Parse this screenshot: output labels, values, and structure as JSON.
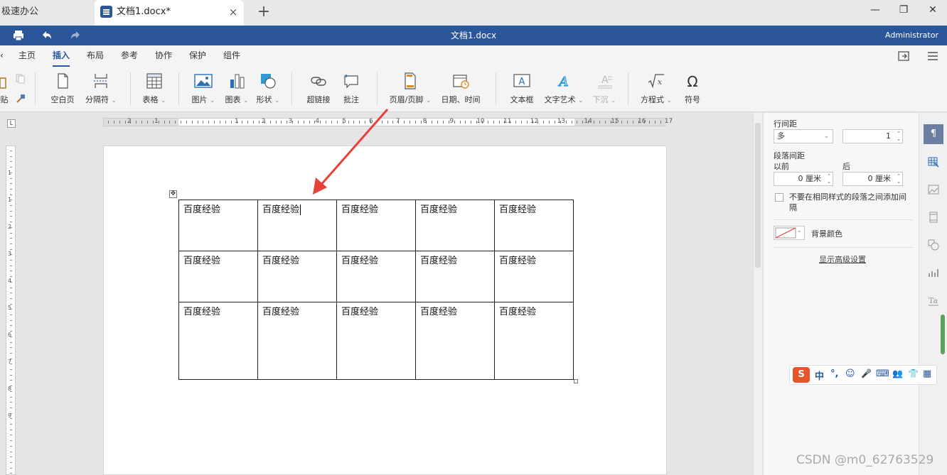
{
  "tabs": {
    "previous_tab_label": "极速办公",
    "active_tab_label": "文档1.docx*",
    "close_glyph": "×",
    "new_tab_glyph": "+"
  },
  "window": {
    "minimize": "—",
    "restore": "❐",
    "close": "✕"
  },
  "titlebar": {
    "title": "文档1.docx",
    "user": "Administrator"
  },
  "menu": {
    "items": [
      "主页",
      "插入",
      "布局",
      "参考",
      "协作",
      "保护",
      "组件"
    ],
    "active": "插入"
  },
  "ribbon": {
    "paste_label": "贴",
    "buttons": [
      {
        "label": "空白页"
      },
      {
        "label": "分隔符"
      },
      {
        "label": "表格"
      },
      {
        "label": "图片"
      },
      {
        "label": "图表"
      },
      {
        "label": "形状"
      },
      {
        "label": "超链接"
      },
      {
        "label": "批注"
      },
      {
        "label": "页眉/页脚"
      },
      {
        "label": "日期、时间"
      },
      {
        "label": "文本框"
      },
      {
        "label": "文字艺术"
      },
      {
        "label": "下沉"
      },
      {
        "label": "方程式"
      },
      {
        "label": "符号"
      }
    ],
    "dropdown_glyph": "⌄"
  },
  "ruler": {
    "h_numbers": [
      "2",
      "1",
      "1",
      "2",
      "3",
      "4",
      "5",
      "6",
      "7",
      "8",
      "9",
      "10",
      "11",
      "12",
      "13",
      "14",
      "15",
      "16",
      "17"
    ],
    "v_numbers": [
      "1",
      "1",
      "2",
      "3",
      "4",
      "5",
      "6",
      "7",
      "8",
      "9"
    ]
  },
  "table": {
    "rows": [
      [
        "百度经验",
        "百度经验",
        "百度经验",
        "百度经验",
        "百度经验"
      ],
      [
        "百度经验",
        "百度经验",
        "百度经验",
        "百度经验",
        "百度经验"
      ],
      [
        "百度经验",
        "百度经验",
        "百度经验",
        "百度经验",
        "百度经验"
      ]
    ]
  },
  "panel": {
    "line_spacing_label": "行间距",
    "line_spacing_mode": "多",
    "line_spacing_value": "1",
    "para_spacing_label": "段落间距",
    "before_label": "以前",
    "after_label": "后",
    "before_value": "0 厘米",
    "after_value": "0 厘米",
    "no_space_checkbox_label": "不要在相同样式的段落之间添加间隔",
    "bg_color_label": "背景颜色",
    "advanced_link": "显示高级设置"
  },
  "ime": {
    "items": [
      "S",
      "中",
      "°,",
      "☺",
      "🎤",
      "⌨",
      "👥",
      "👕",
      "▦"
    ]
  },
  "watermark": "CSDN @m0_62763529",
  "colors": {
    "brand": "#2b579a",
    "annotation_arrow": "#e8413a"
  }
}
